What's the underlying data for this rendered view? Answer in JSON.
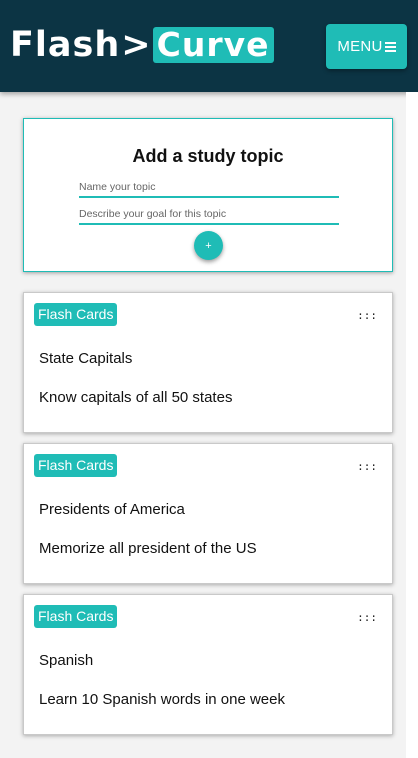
{
  "header": {
    "logo_part1": "Flash",
    "logo_arrow": ">",
    "logo_part2": "Curve",
    "menu_label": "MENU",
    "menu_icon": "hamburger-icon"
  },
  "add_topic": {
    "title": "Add a study topic",
    "name_placeholder": "Name your topic",
    "goal_placeholder": "Describe your goal for this topic",
    "add_button_label": "+"
  },
  "topics": [
    {
      "badge": "Flash Cards",
      "handle": ":::",
      "name": "State Capitals",
      "goal": "Know capitals of all 50 states"
    },
    {
      "badge": "Flash Cards",
      "handle": ":::",
      "name": "Presidents of America",
      "goal": "Memorize all president of the US"
    },
    {
      "badge": "Flash Cards",
      "handle": ":::",
      "name": "Spanish",
      "goal": "Learn 10 Spanish words in one week"
    }
  ],
  "colors": {
    "header_bg": "#0c3444",
    "accent": "#1fbcb6",
    "page_bg": "#f3f3f3"
  }
}
